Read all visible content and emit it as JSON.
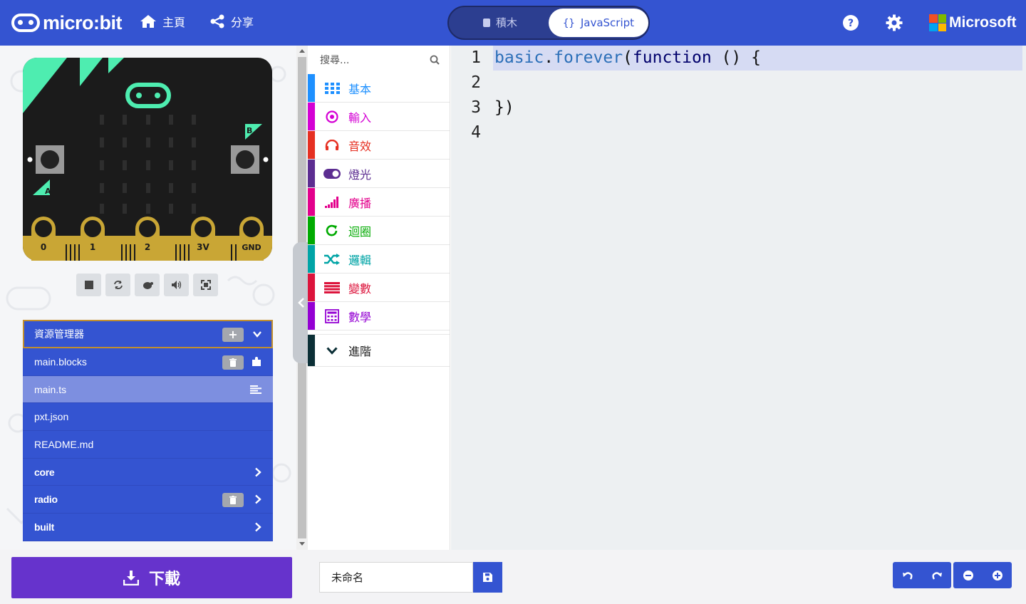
{
  "header": {
    "brand": "micro:bit",
    "home_label": "主頁",
    "share_label": "分享",
    "mode_blocks": "積木",
    "mode_js": "JavaScript",
    "ms_label": "Microsoft",
    "help_icon": "question-circle-icon",
    "settings_icon": "gear-icon"
  },
  "simulator": {
    "pins": [
      "0",
      "1",
      "2",
      "3V",
      "GND"
    ],
    "button_a": "A",
    "button_b": "B",
    "controls": [
      "stop-icon",
      "restart-icon",
      "slow-motion-icon",
      "mute-icon",
      "fullscreen-icon"
    ]
  },
  "explorer": {
    "title": "資源管理器",
    "files": [
      {
        "name": "main.blocks",
        "icon": "puzzle-icon"
      },
      {
        "name": "main.ts",
        "icon": "align-left-icon"
      },
      {
        "name": "pxt.json"
      },
      {
        "name": "README.md"
      },
      {
        "name": "core"
      },
      {
        "name": "radio"
      },
      {
        "name": "built"
      }
    ]
  },
  "toolbox": {
    "search_placeholder": "搜尋...",
    "categories": [
      {
        "label": "基本",
        "color": "#1e90ff",
        "icon": "grid-icon"
      },
      {
        "label": "輸入",
        "color": "#d400d4",
        "icon": "target-icon"
      },
      {
        "label": "音效",
        "color": "#e63022",
        "icon": "headphones-icon"
      },
      {
        "label": "燈光",
        "color": "#5c2d91",
        "icon": "toggle-icon"
      },
      {
        "label": "廣播",
        "color": "#e3008c",
        "icon": "signal-bars-icon"
      },
      {
        "label": "迴圈",
        "color": "#00aa00",
        "icon": "refresh-icon"
      },
      {
        "label": "邏輯",
        "color": "#00a4a6",
        "icon": "shuffle-icon"
      },
      {
        "label": "變數",
        "color": "#dc143c",
        "icon": "list-icon"
      },
      {
        "label": "數學",
        "color": "#9400d3",
        "icon": "calculator-icon"
      }
    ],
    "advanced_label": "進階"
  },
  "editor": {
    "line_numbers": [
      "1",
      "2",
      "3",
      "4"
    ],
    "line1_obj": "basic",
    "line1_dot": ".",
    "line1_fn": "forever",
    "line1_open": "(",
    "line1_kw": "function",
    "line1_rest": " () {",
    "line3": "})"
  },
  "footer": {
    "download_label": "下載",
    "project_name": "未命名",
    "undo_icon": "undo-icon",
    "redo_icon": "redo-icon",
    "zoom_out_icon": "zoom-out-icon",
    "zoom_in_icon": "zoom-in-icon"
  },
  "colors": {
    "header": "#3454d1",
    "download": "#6633cc",
    "board": "#1b1b1b",
    "accent_green": "#4eedb0",
    "gold": "#c9a635"
  }
}
